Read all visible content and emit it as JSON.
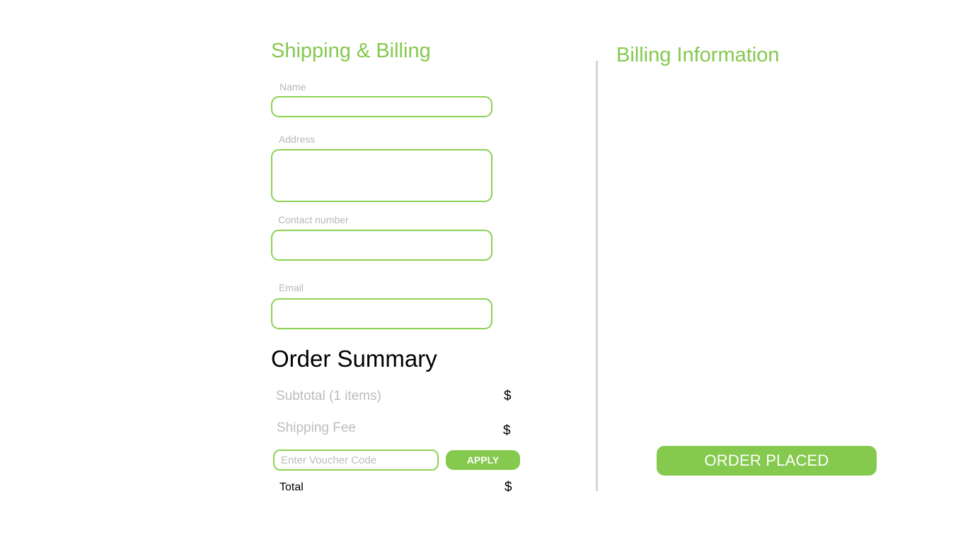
{
  "shipping": {
    "title": "Shipping & Billing",
    "fields": {
      "name": {
        "label": "Name",
        "value": ""
      },
      "address": {
        "label": "Address",
        "value": ""
      },
      "contact": {
        "label": "Contact number",
        "value": ""
      },
      "email": {
        "label": "Email",
        "value": ""
      }
    }
  },
  "order_summary": {
    "title": "Order Summary",
    "subtotal_label": "Subtotal (1 items)",
    "subtotal_value": "$",
    "shipping_fee_label": "Shipping Fee",
    "shipping_fee_value": "$",
    "voucher_placeholder": "Enter Voucher Code",
    "apply_label": "APPLY",
    "total_label": "Total",
    "total_value": "$"
  },
  "billing": {
    "title": "Billing Information",
    "order_button_label": "ORDER PLACED"
  },
  "colors": {
    "accent": "#85c94f",
    "field_border": "#8cd152",
    "muted_text": "#bdbdbd",
    "divider": "#d6d6d6"
  }
}
